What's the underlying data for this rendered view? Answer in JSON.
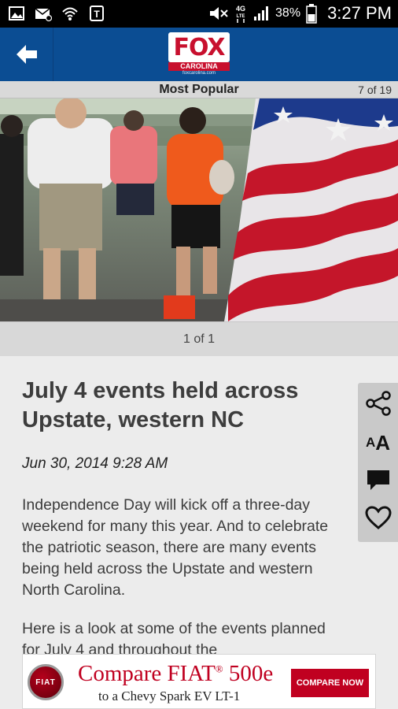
{
  "status_bar": {
    "battery_percent": "38%",
    "time": "3:27 PM",
    "network_label": "4G LTE",
    "left_icons": [
      "gallery-icon",
      "email-icon",
      "hotspot-icon",
      "carrier-icon"
    ],
    "right_icons": [
      "mute-icon",
      "network-4g-icon",
      "signal-icon",
      "battery-icon"
    ]
  },
  "app_bar": {
    "color": "#0b4d93",
    "back_icon": "back-arrow-icon",
    "logo": {
      "brand": "FOX",
      "state": "CAROLINA",
      "url": "foxcarolina.com"
    }
  },
  "section": {
    "title": "Most Popular",
    "position": "7 of 19"
  },
  "gallery": {
    "image_alt": "Crowd at a July 4 event next to an American flag",
    "pager": "1 of 1"
  },
  "article": {
    "headline": "July 4 events held across Upstate, western NC",
    "date": "Jun 30, 2014 9:28 AM",
    "paragraphs": [
      "Independence Day will kick off a three-day weekend for many this year. And to celebrate the patriotic season, there are many events being held across the Upstate and western North Carolina.",
      "Here is a look at some of the events planned for July 4 and throughout the"
    ]
  },
  "actions": {
    "share_icon": "share-icon",
    "text_size_label_small": "A",
    "text_size_label_big": "A",
    "comment_icon": "comment-icon",
    "favorite_icon": "heart-icon"
  },
  "ad": {
    "brand_logo": "FIAT",
    "headline_main": "Compare FIAT",
    "headline_mark": "®",
    "headline_model": " 500e",
    "subline": "to a Chevy Spark EV LT-1",
    "cta": "COMPARE NOW",
    "accent": "#c00020"
  }
}
